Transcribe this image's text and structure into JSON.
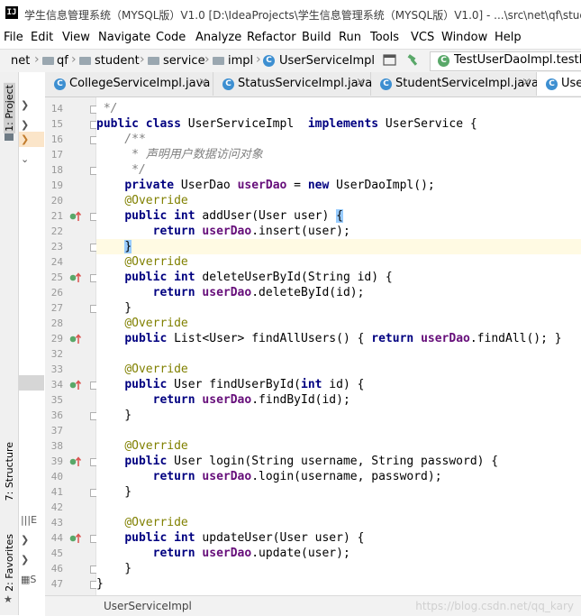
{
  "title": "学生信息管理系统（MYSQL版）V1.0 [D:\\IdeaProjects\\学生信息管理系统（MYSQL版）V1.0] - ...\\src\\net\\qf\\stud",
  "menu": [
    "File",
    "Edit",
    "View",
    "Navigate",
    "Code",
    "Analyze",
    "Refactor",
    "Build",
    "Run",
    "Tools",
    "VCS",
    "Window",
    "Help"
  ],
  "breadcrumb": [
    "net",
    "qf",
    "student",
    "service",
    "impl",
    "UserServiceImpl"
  ],
  "run_config": "TestUserDaoImpl.testLo",
  "tool_windows": {
    "project": "1: Project",
    "structure": "7: Structure",
    "favorites": "2: Favorites"
  },
  "tabs": [
    {
      "label": "CollegeServiceImpl.java",
      "active": false
    },
    {
      "label": "StatusServiceImpl.java",
      "active": false
    },
    {
      "label": "StudentServiceImpl.java",
      "active": false
    },
    {
      "label": "Use",
      "active": true
    }
  ],
  "code_lines": [
    {
      "no": "14",
      "text": " */"
    },
    {
      "no": "15",
      "text": "public class UserServiceImpl  implements UserService {"
    },
    {
      "no": "16",
      "text": "    /**"
    },
    {
      "no": "17",
      "text": "     * 声明用户数据访问对象"
    },
    {
      "no": "18",
      "text": "     */"
    },
    {
      "no": "19",
      "text": "    private UserDao userDao = new UserDaoImpl();"
    },
    {
      "no": "20",
      "text": "    @Override"
    },
    {
      "no": "21",
      "text": "    public int addUser(User user) {"
    },
    {
      "no": "22",
      "text": "        return userDao.insert(user);"
    },
    {
      "no": "23",
      "text": "    }"
    },
    {
      "no": "24",
      "text": "    @Override"
    },
    {
      "no": "25",
      "text": "    public int deleteUserById(String id) {"
    },
    {
      "no": "26",
      "text": "        return userDao.deleteById(id);"
    },
    {
      "no": "27",
      "text": "    }"
    },
    {
      "no": "28",
      "text": "    @Override"
    },
    {
      "no": "29",
      "text": "    public List<User> findAllUsers() { return userDao.findAll(); }"
    },
    {
      "no": "32",
      "text": ""
    },
    {
      "no": "33",
      "text": "    @Override"
    },
    {
      "no": "34",
      "text": "    public User findUserById(int id) {"
    },
    {
      "no": "35",
      "text": "        return userDao.findById(id);"
    },
    {
      "no": "36",
      "text": "    }"
    },
    {
      "no": "37",
      "text": ""
    },
    {
      "no": "38",
      "text": "    @Override"
    },
    {
      "no": "39",
      "text": "    public User login(String username, String password) {"
    },
    {
      "no": "40",
      "text": "        return userDao.login(username, password);"
    },
    {
      "no": "41",
      "text": "    }"
    },
    {
      "no": "42",
      "text": ""
    },
    {
      "no": "43",
      "text": "    @Override"
    },
    {
      "no": "44",
      "text": "    public int updateUser(User user) {"
    },
    {
      "no": "45",
      "text": "        return userDao.update(user);"
    },
    {
      "no": "46",
      "text": "    }"
    },
    {
      "no": "47",
      "text": "}"
    }
  ],
  "override_marker_lines": [
    "21",
    "25",
    "29",
    "34",
    "39",
    "44"
  ],
  "current_line": "23",
  "status_file": "UserServiceImpl",
  "watermark": "https://blog.csdn.net/qq_kary",
  "colors": {
    "keyword": "#000080",
    "field": "#660e7a",
    "annotation": "#808000",
    "comment": "#808080",
    "current_line": "#fffae3",
    "class_icon": "#3d8fd1"
  },
  "icons": [
    "intellij-icon",
    "folder-icon",
    "class-icon",
    "build-hammer-icon",
    "override-arrow-icon"
  ]
}
